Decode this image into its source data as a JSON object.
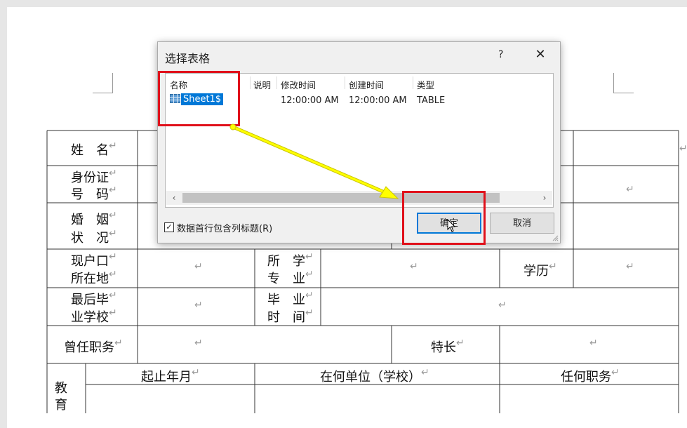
{
  "document": {
    "form_labels": {
      "name": "姓　名",
      "id_line1": "身份证",
      "id_line2": "号　码",
      "marriage_line1": "婚　姻",
      "marriage_line2": "状　况",
      "hukou_line1": "现户口",
      "hukou_line2": "所在地",
      "major_line1": "所　学",
      "major_line2": "专　业",
      "education": "学历",
      "school_line1": "最后毕",
      "school_line2": "业学校",
      "grad_line1": "毕　业",
      "grad_line2": "时　间",
      "former_post": "曾任职务",
      "specialty": "特长",
      "period": "起止年月",
      "unit": "在何单位（学校）",
      "position": "任何职务",
      "edu_line1": "教",
      "edu_line2": "育"
    },
    "paragraph_mark": "↵"
  },
  "dialog": {
    "title": "选择表格",
    "help_label": "?",
    "close_label": "✕",
    "columns": [
      "名称",
      "说明",
      "修改时间",
      "创建时间",
      "类型"
    ],
    "rows": [
      {
        "name": "Sheet1$",
        "description": "",
        "modified": "12:00:00 AM",
        "created": "12:00:00 AM",
        "type": "TABLE"
      }
    ],
    "checkbox": {
      "label": "数据首行包含列标题(R)",
      "checked": true
    },
    "ok_label": "确定",
    "cancel_label": "取消"
  },
  "annotations": {
    "highlight_color": "#e0111b",
    "arrow_color": "#ffff00"
  }
}
